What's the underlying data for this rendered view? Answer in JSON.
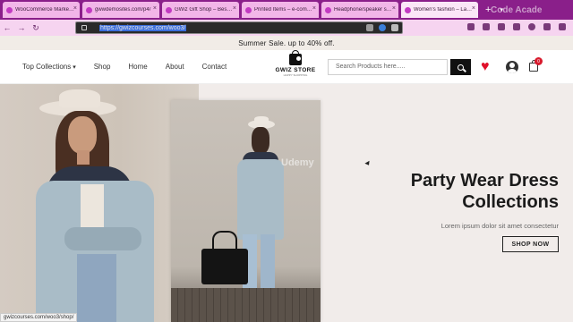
{
  "browser": {
    "tabs": [
      {
        "title": "WooCommerce Marketplace",
        "active": false
      },
      {
        "title": "gwwdemosites.com/p4/",
        "active": false
      },
      {
        "title": "GWiz Gift Shop – Best Gift",
        "active": false
      },
      {
        "title": "Printed Items – e-commerce",
        "active": false
      },
      {
        "title": "Headphone/speaker store",
        "active": false
      },
      {
        "title": "Women's fashion – Latest",
        "active": true
      }
    ],
    "new_tab": "+",
    "url_selected": "https://gwizcourses.com/woo3/",
    "status_url": "gwizcourses.com/woo3/shop/",
    "watermark_top": "Code Acade"
  },
  "site": {
    "promo": "Summer Sale. up to 40% off.",
    "menu": [
      "Top Collections",
      "Shop",
      "Home",
      "About",
      "Contact"
    ],
    "logo_name": "GWIZ STORE",
    "logo_tag": "HAPPY SHOPPING",
    "search_placeholder": "Search Products here.....",
    "cart_count": "0"
  },
  "hero": {
    "title_line1": "Party Wear Dress",
    "title_line2": "Collections",
    "subtitle": "Lorem ipsum dolor sit amet consectetur",
    "cta": "SHOP NOW",
    "watermark": "Udemy"
  },
  "colors": {
    "tabbar": "#8a1f8a",
    "accent_red": "#e0102a",
    "hero_bg": "#f1ecea"
  }
}
